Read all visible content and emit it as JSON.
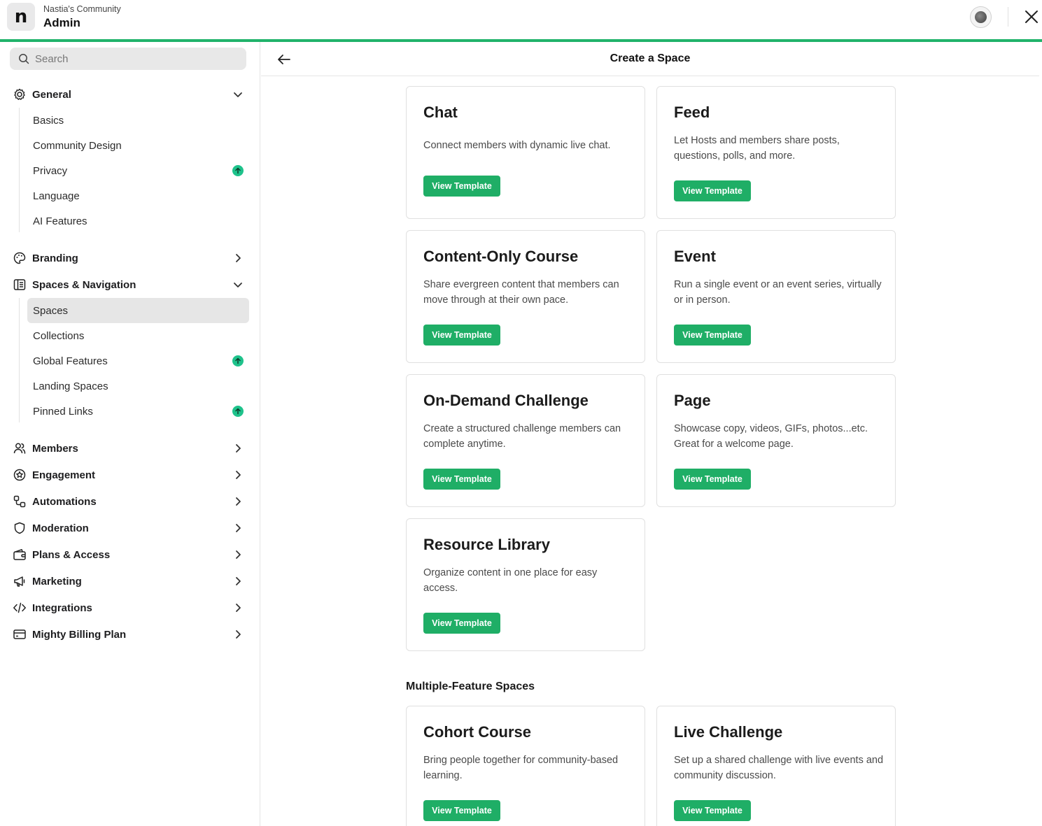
{
  "header": {
    "logo_letter": "n",
    "community_name": "Nastia's Community",
    "title": "Admin",
    "accent_color": "#21b36b"
  },
  "sidebar": {
    "search_placeholder": "Search",
    "sections": {
      "general": {
        "label": "General",
        "icon": "gear-icon",
        "expanded": true,
        "items": [
          {
            "label": "Basics"
          },
          {
            "label": "Community Design"
          },
          {
            "label": "Privacy",
            "badge": "upgrade-icon"
          },
          {
            "label": "Language"
          },
          {
            "label": "AI Features"
          }
        ]
      },
      "branding": {
        "label": "Branding",
        "icon": "palette-icon"
      },
      "spaces_nav": {
        "label": "Spaces & Navigation",
        "icon": "layout-icon",
        "expanded": true,
        "items": [
          {
            "label": "Spaces",
            "active": true
          },
          {
            "label": "Collections"
          },
          {
            "label": "Global Features",
            "badge": "upgrade-icon"
          },
          {
            "label": "Landing Spaces"
          },
          {
            "label": "Pinned Links",
            "badge": "upgrade-icon"
          }
        ]
      },
      "members": {
        "label": "Members",
        "icon": "users-icon"
      },
      "engagement": {
        "label": "Engagement",
        "icon": "star-badge-icon"
      },
      "automations": {
        "label": "Automations",
        "icon": "flow-icon"
      },
      "moderation": {
        "label": "Moderation",
        "icon": "shield-icon"
      },
      "plans": {
        "label": "Plans & Access",
        "icon": "wallet-icon"
      },
      "marketing": {
        "label": "Marketing",
        "icon": "megaphone-icon"
      },
      "integrations": {
        "label": "Integrations",
        "icon": "code-icon"
      },
      "billing": {
        "label": "Mighty Billing Plan",
        "icon": "credit-card-icon"
      }
    }
  },
  "main": {
    "title": "Create a Space",
    "button_label": "View Template",
    "button_color": "#1fae66",
    "cards": [
      {
        "title": "Chat",
        "description": "Connect members with dynamic live chat."
      },
      {
        "title": "Feed",
        "description": "Let Hosts and members share posts, questions, polls, and more."
      },
      {
        "title": "Content-Only Course",
        "description": "Share evergreen content that members can move through at their own pace."
      },
      {
        "title": "Event",
        "description": "Run a single event or an event series, virtually or in person."
      },
      {
        "title": "On-Demand Challenge",
        "description": "Create a structured challenge members can complete anytime."
      },
      {
        "title": "Page",
        "description": "Showcase copy, videos, GIFs, photos...etc. Great for a welcome page."
      },
      {
        "title": "Resource Library",
        "description": "Organize content in one place for easy access."
      }
    ],
    "multi_section_label": "Multiple-Feature Spaces",
    "multi_cards": [
      {
        "title": "Cohort Course",
        "description": "Bring people together for community-based learning."
      },
      {
        "title": "Live Challenge",
        "description": "Set up a shared challenge with live events and community discussion."
      }
    ]
  }
}
